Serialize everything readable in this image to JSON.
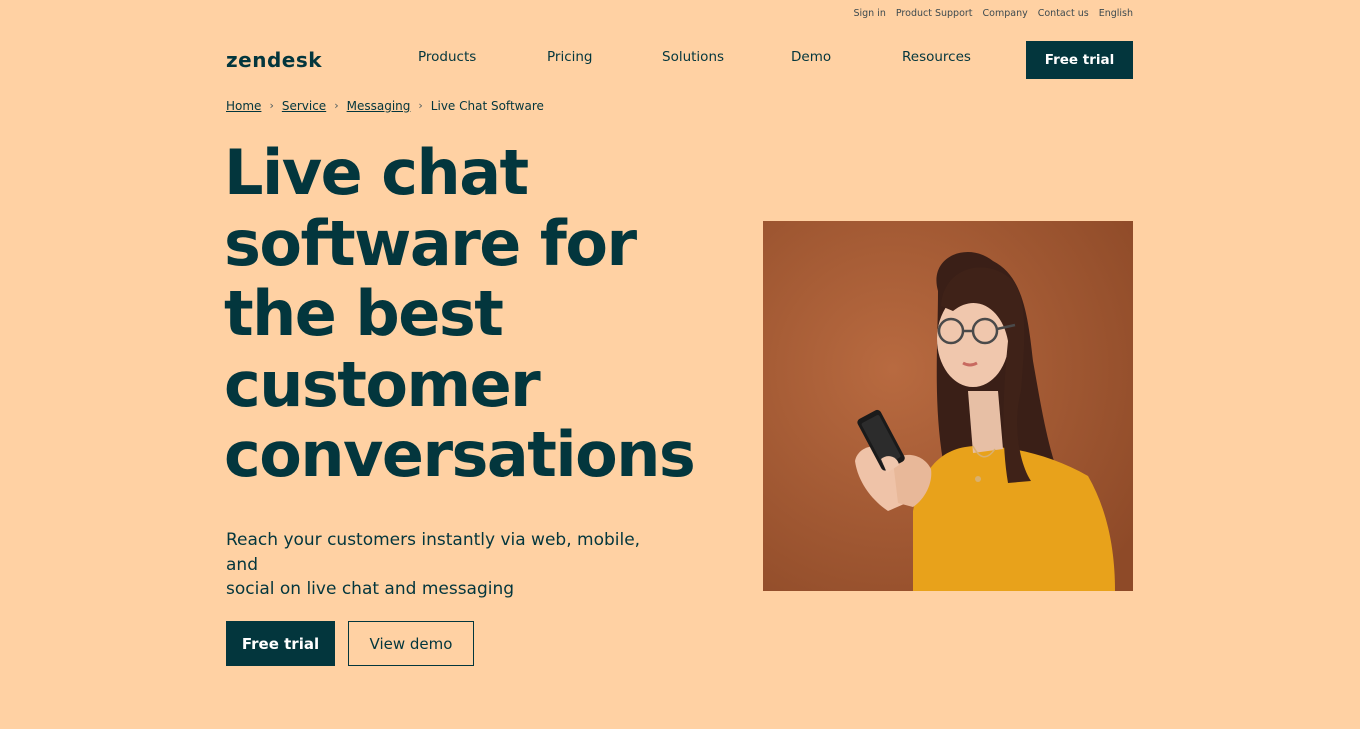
{
  "utility_nav": [
    "Sign in",
    "Product Support",
    "Company",
    "Contact us",
    "English"
  ],
  "brand": {
    "logo_text": "zendesk"
  },
  "nav": {
    "items": [
      "Products",
      "Pricing",
      "Solutions",
      "Demo",
      "Resources"
    ],
    "cta_label": "Free trial"
  },
  "breadcrumb": {
    "items": [
      "Home",
      "Service",
      "Messaging"
    ],
    "current": "Live Chat Software",
    "separator": "›"
  },
  "hero": {
    "title_lines": [
      "Live chat",
      "software for",
      "the best",
      "customer",
      "conversations"
    ],
    "subtitle_lines": [
      "Reach your customers instantly via web, mobile, and",
      "social on live chat and messaging"
    ],
    "primary_cta": "Free trial",
    "secondary_cta": "View demo"
  },
  "colors": {
    "background": "#ffd1a3",
    "brand_dark": "#03363d",
    "photo_backdrop": "#a75c36",
    "shirt": "#e8a21b"
  },
  "icons": {
    "breadcrumb_separator": "chevron-right-icon"
  }
}
